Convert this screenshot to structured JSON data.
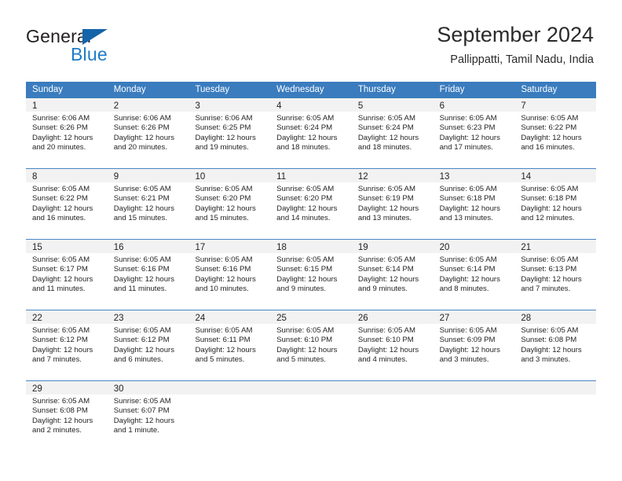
{
  "brand": {
    "name_part1": "General",
    "name_part2": "Blue",
    "triangle_color": "#1464aa",
    "blue_color": "#1e7bc8"
  },
  "header": {
    "title": "September 2024",
    "location": "Pallippatti, Tamil Nadu, India"
  },
  "calendar": {
    "header_bg": "#3a7cbe",
    "header_text_color": "#ffffff",
    "daynum_band_bg": "#f2f2f2",
    "weekdays": [
      "Sunday",
      "Monday",
      "Tuesday",
      "Wednesday",
      "Thursday",
      "Friday",
      "Saturday"
    ],
    "weeks": [
      [
        {
          "day": "1",
          "sunrise": "Sunrise: 6:06 AM",
          "sunset": "Sunset: 6:26 PM",
          "daylight1": "Daylight: 12 hours",
          "daylight2": "and 20 minutes."
        },
        {
          "day": "2",
          "sunrise": "Sunrise: 6:06 AM",
          "sunset": "Sunset: 6:26 PM",
          "daylight1": "Daylight: 12 hours",
          "daylight2": "and 20 minutes."
        },
        {
          "day": "3",
          "sunrise": "Sunrise: 6:06 AM",
          "sunset": "Sunset: 6:25 PM",
          "daylight1": "Daylight: 12 hours",
          "daylight2": "and 19 minutes."
        },
        {
          "day": "4",
          "sunrise": "Sunrise: 6:05 AM",
          "sunset": "Sunset: 6:24 PM",
          "daylight1": "Daylight: 12 hours",
          "daylight2": "and 18 minutes."
        },
        {
          "day": "5",
          "sunrise": "Sunrise: 6:05 AM",
          "sunset": "Sunset: 6:24 PM",
          "daylight1": "Daylight: 12 hours",
          "daylight2": "and 18 minutes."
        },
        {
          "day": "6",
          "sunrise": "Sunrise: 6:05 AM",
          "sunset": "Sunset: 6:23 PM",
          "daylight1": "Daylight: 12 hours",
          "daylight2": "and 17 minutes."
        },
        {
          "day": "7",
          "sunrise": "Sunrise: 6:05 AM",
          "sunset": "Sunset: 6:22 PM",
          "daylight1": "Daylight: 12 hours",
          "daylight2": "and 16 minutes."
        }
      ],
      [
        {
          "day": "8",
          "sunrise": "Sunrise: 6:05 AM",
          "sunset": "Sunset: 6:22 PM",
          "daylight1": "Daylight: 12 hours",
          "daylight2": "and 16 minutes."
        },
        {
          "day": "9",
          "sunrise": "Sunrise: 6:05 AM",
          "sunset": "Sunset: 6:21 PM",
          "daylight1": "Daylight: 12 hours",
          "daylight2": "and 15 minutes."
        },
        {
          "day": "10",
          "sunrise": "Sunrise: 6:05 AM",
          "sunset": "Sunset: 6:20 PM",
          "daylight1": "Daylight: 12 hours",
          "daylight2": "and 15 minutes."
        },
        {
          "day": "11",
          "sunrise": "Sunrise: 6:05 AM",
          "sunset": "Sunset: 6:20 PM",
          "daylight1": "Daylight: 12 hours",
          "daylight2": "and 14 minutes."
        },
        {
          "day": "12",
          "sunrise": "Sunrise: 6:05 AM",
          "sunset": "Sunset: 6:19 PM",
          "daylight1": "Daylight: 12 hours",
          "daylight2": "and 13 minutes."
        },
        {
          "day": "13",
          "sunrise": "Sunrise: 6:05 AM",
          "sunset": "Sunset: 6:18 PM",
          "daylight1": "Daylight: 12 hours",
          "daylight2": "and 13 minutes."
        },
        {
          "day": "14",
          "sunrise": "Sunrise: 6:05 AM",
          "sunset": "Sunset: 6:18 PM",
          "daylight1": "Daylight: 12 hours",
          "daylight2": "and 12 minutes."
        }
      ],
      [
        {
          "day": "15",
          "sunrise": "Sunrise: 6:05 AM",
          "sunset": "Sunset: 6:17 PM",
          "daylight1": "Daylight: 12 hours",
          "daylight2": "and 11 minutes."
        },
        {
          "day": "16",
          "sunrise": "Sunrise: 6:05 AM",
          "sunset": "Sunset: 6:16 PM",
          "daylight1": "Daylight: 12 hours",
          "daylight2": "and 11 minutes."
        },
        {
          "day": "17",
          "sunrise": "Sunrise: 6:05 AM",
          "sunset": "Sunset: 6:16 PM",
          "daylight1": "Daylight: 12 hours",
          "daylight2": "and 10 minutes."
        },
        {
          "day": "18",
          "sunrise": "Sunrise: 6:05 AM",
          "sunset": "Sunset: 6:15 PM",
          "daylight1": "Daylight: 12 hours",
          "daylight2": "and 9 minutes."
        },
        {
          "day": "19",
          "sunrise": "Sunrise: 6:05 AM",
          "sunset": "Sunset: 6:14 PM",
          "daylight1": "Daylight: 12 hours",
          "daylight2": "and 9 minutes."
        },
        {
          "day": "20",
          "sunrise": "Sunrise: 6:05 AM",
          "sunset": "Sunset: 6:14 PM",
          "daylight1": "Daylight: 12 hours",
          "daylight2": "and 8 minutes."
        },
        {
          "day": "21",
          "sunrise": "Sunrise: 6:05 AM",
          "sunset": "Sunset: 6:13 PM",
          "daylight1": "Daylight: 12 hours",
          "daylight2": "and 7 minutes."
        }
      ],
      [
        {
          "day": "22",
          "sunrise": "Sunrise: 6:05 AM",
          "sunset": "Sunset: 6:12 PM",
          "daylight1": "Daylight: 12 hours",
          "daylight2": "and 7 minutes."
        },
        {
          "day": "23",
          "sunrise": "Sunrise: 6:05 AM",
          "sunset": "Sunset: 6:12 PM",
          "daylight1": "Daylight: 12 hours",
          "daylight2": "and 6 minutes."
        },
        {
          "day": "24",
          "sunrise": "Sunrise: 6:05 AM",
          "sunset": "Sunset: 6:11 PM",
          "daylight1": "Daylight: 12 hours",
          "daylight2": "and 5 minutes."
        },
        {
          "day": "25",
          "sunrise": "Sunrise: 6:05 AM",
          "sunset": "Sunset: 6:10 PM",
          "daylight1": "Daylight: 12 hours",
          "daylight2": "and 5 minutes."
        },
        {
          "day": "26",
          "sunrise": "Sunrise: 6:05 AM",
          "sunset": "Sunset: 6:10 PM",
          "daylight1": "Daylight: 12 hours",
          "daylight2": "and 4 minutes."
        },
        {
          "day": "27",
          "sunrise": "Sunrise: 6:05 AM",
          "sunset": "Sunset: 6:09 PM",
          "daylight1": "Daylight: 12 hours",
          "daylight2": "and 3 minutes."
        },
        {
          "day": "28",
          "sunrise": "Sunrise: 6:05 AM",
          "sunset": "Sunset: 6:08 PM",
          "daylight1": "Daylight: 12 hours",
          "daylight2": "and 3 minutes."
        }
      ],
      [
        {
          "day": "29",
          "sunrise": "Sunrise: 6:05 AM",
          "sunset": "Sunset: 6:08 PM",
          "daylight1": "Daylight: 12 hours",
          "daylight2": "and 2 minutes."
        },
        {
          "day": "30",
          "sunrise": "Sunrise: 6:05 AM",
          "sunset": "Sunset: 6:07 PM",
          "daylight1": "Daylight: 12 hours",
          "daylight2": "and 1 minute."
        },
        {
          "day": "",
          "sunrise": "",
          "sunset": "",
          "daylight1": "",
          "daylight2": ""
        },
        {
          "day": "",
          "sunrise": "",
          "sunset": "",
          "daylight1": "",
          "daylight2": ""
        },
        {
          "day": "",
          "sunrise": "",
          "sunset": "",
          "daylight1": "",
          "daylight2": ""
        },
        {
          "day": "",
          "sunrise": "",
          "sunset": "",
          "daylight1": "",
          "daylight2": ""
        },
        {
          "day": "",
          "sunrise": "",
          "sunset": "",
          "daylight1": "",
          "daylight2": ""
        }
      ]
    ]
  }
}
